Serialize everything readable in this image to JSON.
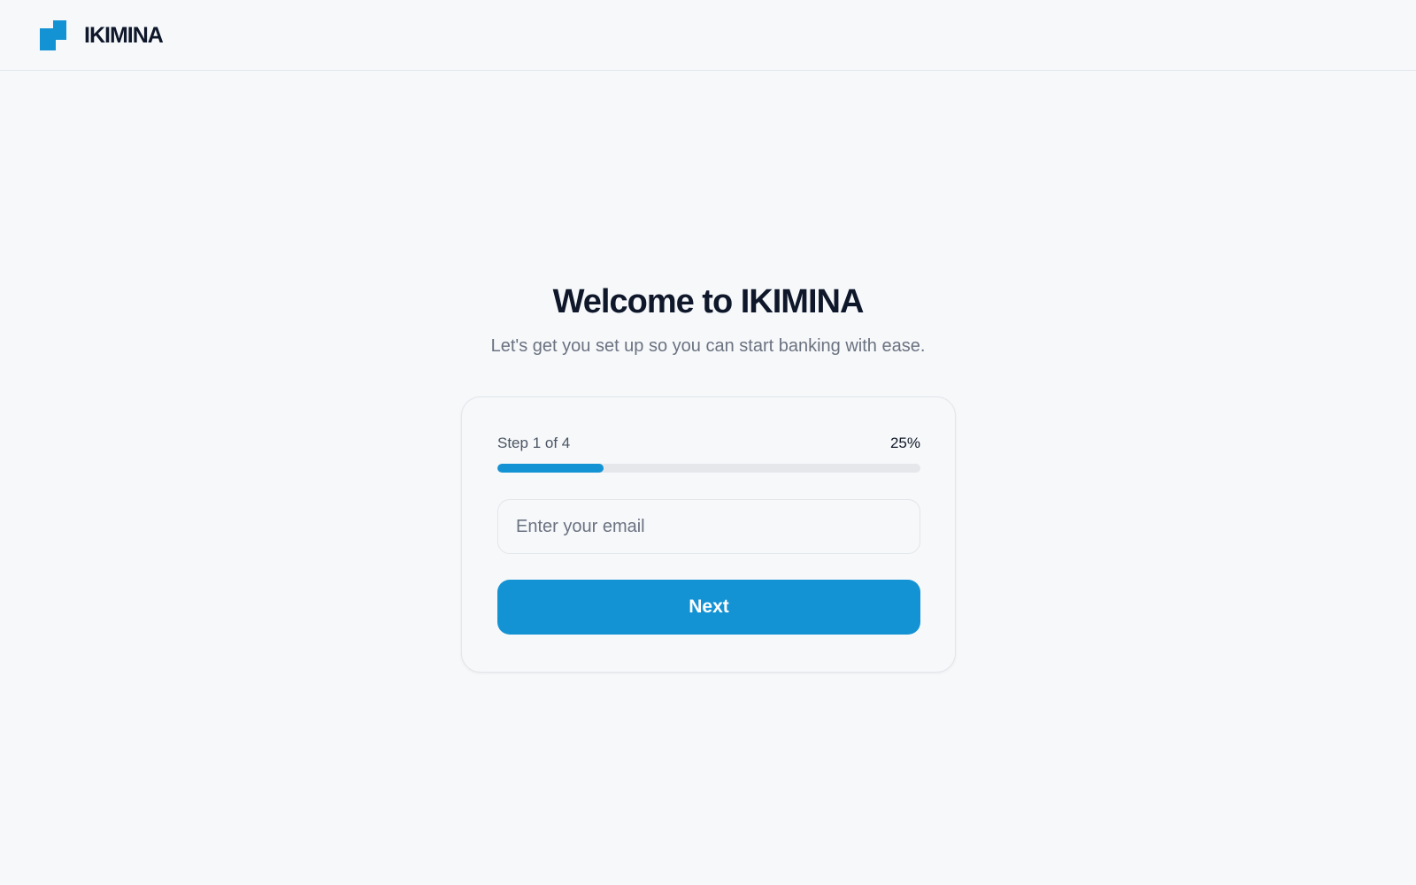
{
  "header": {
    "brand_name": "IKIMINA",
    "logo_icon": "ikimina-logo-icon",
    "accent_color": "#1493d4"
  },
  "welcome": {
    "title": "Welcome to IKIMINA",
    "subtitle": "Let's get you set up so you can start banking with ease."
  },
  "onboarding": {
    "step_label": "Step 1 of 4",
    "progress_percent_label": "25%",
    "progress_fraction": 0.25,
    "email_input": {
      "placeholder": "Enter your email",
      "value": ""
    },
    "next_button_label": "Next"
  }
}
